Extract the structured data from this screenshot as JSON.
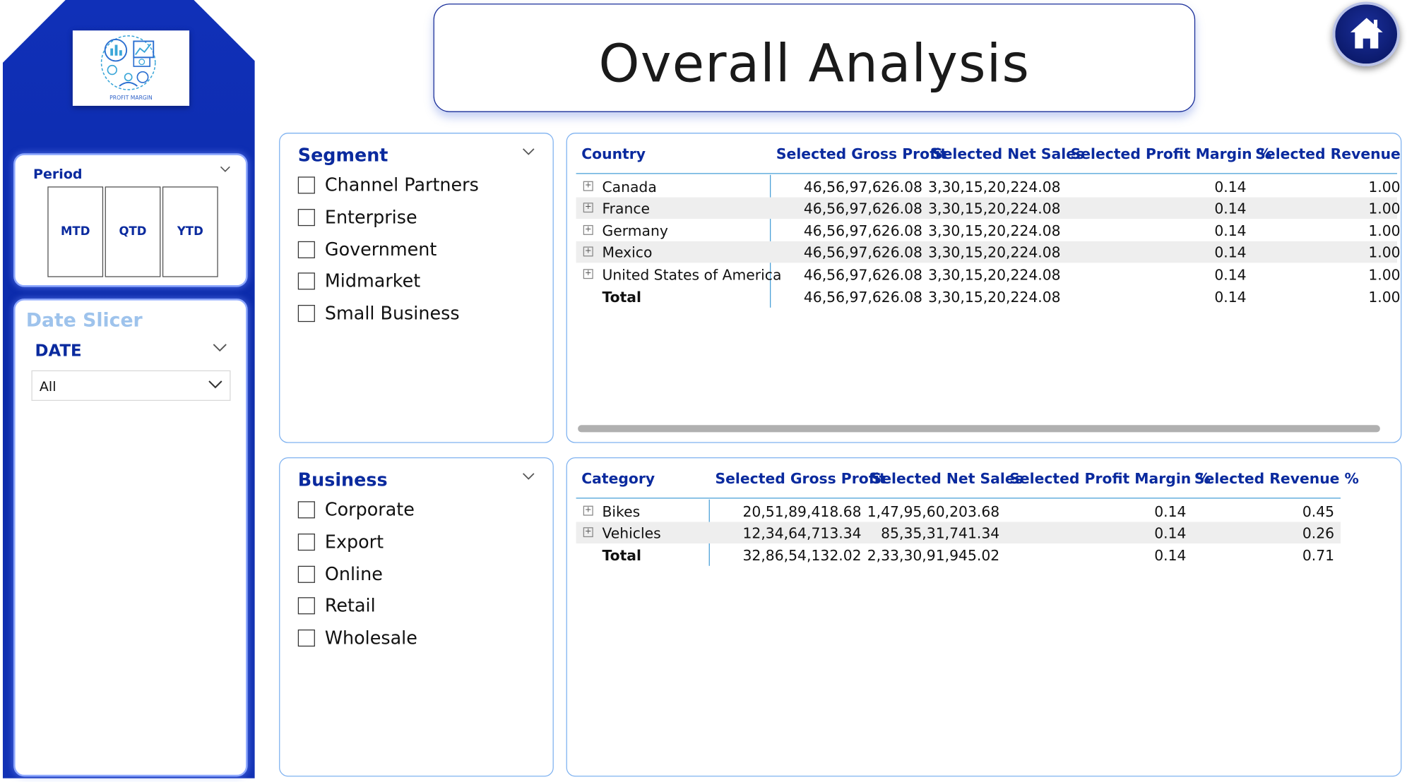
{
  "logo": {
    "caption": "PROFIT MARGIN",
    "icon": "profit-margin-logo"
  },
  "title": "Overall Analysis",
  "home": {
    "icon": "home-icon"
  },
  "period": {
    "title": "Period",
    "buttons": [
      "MTD",
      "QTD",
      "YTD"
    ]
  },
  "date_slicer": {
    "title": "Date Slicer",
    "field_label": "DATE",
    "selected": "All"
  },
  "segment": {
    "title": "Segment",
    "items": [
      "Channel Partners",
      "Enterprise",
      "Government",
      "Midmarket",
      "Small Business"
    ]
  },
  "business": {
    "title": "Business",
    "items": [
      "Corporate",
      "Export",
      "Online",
      "Retail",
      "Wholesale"
    ]
  },
  "country_table": {
    "headers": [
      "Country",
      "Selected Gross Profit",
      "Selected Net Sales",
      "Selected Profit Margin %",
      "Selected Revenue %"
    ],
    "rows": [
      {
        "name": "Canada",
        "gross": "46,56,97,626.08",
        "net": "3,30,15,20,224.08",
        "margin": "0.14",
        "revenue": "1.00"
      },
      {
        "name": "France",
        "gross": "46,56,97,626.08",
        "net": "3,30,15,20,224.08",
        "margin": "0.14",
        "revenue": "1.00"
      },
      {
        "name": "Germany",
        "gross": "46,56,97,626.08",
        "net": "3,30,15,20,224.08",
        "margin": "0.14",
        "revenue": "1.00"
      },
      {
        "name": "Mexico",
        "gross": "46,56,97,626.08",
        "net": "3,30,15,20,224.08",
        "margin": "0.14",
        "revenue": "1.00"
      },
      {
        "name": "United States of America",
        "gross": "46,56,97,626.08",
        "net": "3,30,15,20,224.08",
        "margin": "0.14",
        "revenue": "1.00"
      }
    ],
    "total": {
      "name": "Total",
      "gross": "46,56,97,626.08",
      "net": "3,30,15,20,224.08",
      "margin": "0.14",
      "revenue": "1.00"
    }
  },
  "category_table": {
    "headers": [
      "Category",
      "Selected Gross Profit",
      "Selected Net Sales",
      "Selected Profit Margin %",
      "Selected Revenue %"
    ],
    "rows": [
      {
        "name": "Bikes",
        "gross": "20,51,89,418.68",
        "net": "1,47,95,60,203.68",
        "margin": "0.14",
        "revenue": "0.45"
      },
      {
        "name": "Vehicles",
        "gross": "12,34,64,713.34",
        "net": "85,35,31,741.34",
        "margin": "0.14",
        "revenue": "0.26"
      }
    ],
    "total": {
      "name": "Total",
      "gross": "32,86,54,132.02",
      "net": "2,33,30,91,945.02",
      "margin": "0.14",
      "revenue": "0.71"
    }
  },
  "colors": {
    "sidebar": "#0b2aa8",
    "accent": "#0a2a9e",
    "panel_border": "#7fb2f0"
  }
}
